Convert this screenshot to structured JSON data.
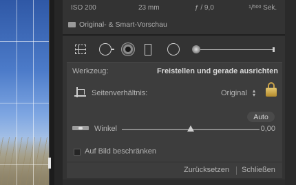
{
  "exif": {
    "iso": "ISO 200",
    "focal": "23 mm",
    "aperture": "ƒ / 9,0",
    "shutter_num": "1",
    "shutter_den": "500",
    "shutter_unit": "Sek."
  },
  "preview": {
    "label": "Original- & Smart-Vorschau",
    "icon": "preview-icon"
  },
  "tools": [
    {
      "name": "crop-tool",
      "icon": "crop-overlay-icon"
    },
    {
      "name": "spot-removal-tool",
      "icon": "spot-removal-icon"
    },
    {
      "name": "red-eye-tool",
      "icon": "red-eye-icon"
    },
    {
      "name": "graduated-filter-tool",
      "icon": "graduated-filter-icon"
    },
    {
      "name": "radial-filter-tool",
      "icon": "radial-filter-icon"
    },
    {
      "name": "adjustment-brush-tool",
      "icon": "adjustment-brush-icon"
    }
  ],
  "crop": {
    "tool_label": "Werkzeug:",
    "tool_value": "Freistellen und gerade ausrichten",
    "aspect_label": "Seitenverhältnis:",
    "aspect_value": "Original",
    "aspect_locked": true,
    "auto_label": "Auto",
    "angle_label": "Winkel",
    "angle_value": "0,00",
    "angle_slider_fraction": 0.5,
    "constrain_label": "Auf Bild beschränken",
    "constrain_checked": false,
    "reset_label": "Zurücksetzen",
    "close_label": "Schließen"
  },
  "colors": {
    "panel_bg": "#333333",
    "subpanel_bg": "#3d3d3d",
    "text": "#b4b4b4",
    "lock_gold": "#c9a24a"
  }
}
